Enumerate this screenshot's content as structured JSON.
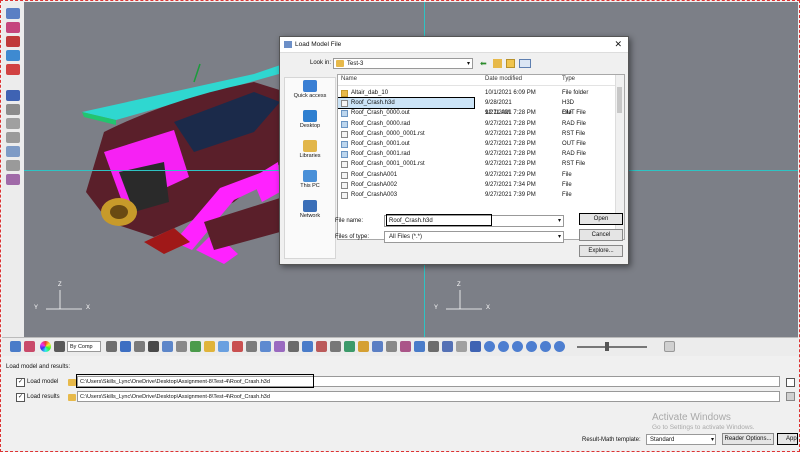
{
  "dialog": {
    "title": "Load Model File",
    "look_in_label": "Look in:",
    "look_in_value": "Test-3",
    "places": [
      "Quick access",
      "Desktop",
      "Libraries",
      "This PC",
      "Network"
    ],
    "columns": {
      "name": "Name",
      "date": "Date modified",
      "type": "Type"
    },
    "files": [
      {
        "name": "Altair_dab_10",
        "date": "10/1/2021 6:09 PM",
        "type": "File folder",
        "icon": "folder"
      },
      {
        "name": "Roof_Crash.h3d",
        "date": "9/28/2021 12:11 AM",
        "type": "H3D File",
        "icon": "doc"
      },
      {
        "name": "Roof_Crash_0000.out",
        "date": "9/27/2021 7:28 PM",
        "type": "OUT File",
        "icon": "img"
      },
      {
        "name": "Roof_Crash_0000.rad",
        "date": "9/27/2021 7:28 PM",
        "type": "RAD File",
        "icon": "img"
      },
      {
        "name": "Roof_Crash_0000_0001.rst",
        "date": "9/27/2021 7:28 PM",
        "type": "RST File",
        "icon": "doc"
      },
      {
        "name": "Roof_Crash_0001.out",
        "date": "9/27/2021 7:28 PM",
        "type": "OUT File",
        "icon": "img"
      },
      {
        "name": "Roof_Crash_0001.rad",
        "date": "9/27/2021 7:28 PM",
        "type": "RAD File",
        "icon": "img"
      },
      {
        "name": "Roof_Crash_0001_0001.rst",
        "date": "9/27/2021 7:28 PM",
        "type": "RST File",
        "icon": "doc"
      },
      {
        "name": "Roof_CrashA001",
        "date": "9/27/2021 7:29 PM",
        "type": "File",
        "icon": "doc"
      },
      {
        "name": "Roof_CrashA002",
        "date": "9/27/2021 7:34 PM",
        "type": "File",
        "icon": "doc"
      },
      {
        "name": "Roof_CrashA003",
        "date": "9/27/2021 7:39 PM",
        "type": "File",
        "icon": "doc"
      }
    ],
    "file_name_label": "File name:",
    "file_name_value": "Roof_Crash.h3d",
    "file_type_label": "Files of type:",
    "file_type_value": "All Files (*.*)",
    "open_button": "Open",
    "cancel_button": "Cancel",
    "browse_button": "Explore..."
  },
  "viewport": {
    "triad_x": "X",
    "triad_y": "Y",
    "triad_z": "Z"
  },
  "toolbar": {
    "color_mode": "By Comp"
  },
  "panel": {
    "heading": "Load model and results:",
    "load_model_label": "Load model",
    "load_model_path": "C:\\Users\\Skills_Lync\\OneDrive\\Desktop\\Assignment-8\\Test-4\\Roof_Crash.h3d",
    "load_results_label": "Load results",
    "load_results_path": "C:\\Users\\Skills_Lync\\OneDrive\\Desktop\\Assignment-8\\Test-4\\Roof_Crash.h3d",
    "template_label": "Result-Math template:",
    "template_value": "Standard",
    "reader_options_button": "Reader Options...",
    "apply_button": "App"
  },
  "watermark": {
    "line1": "Activate Windows",
    "line2": "Go to Settings to activate Windows."
  },
  "colors": {
    "viewport_bg": "#7c7f87",
    "magenta": "#ff22ff",
    "highlight_box": "#000000",
    "frame_dash": "#dd3333"
  }
}
